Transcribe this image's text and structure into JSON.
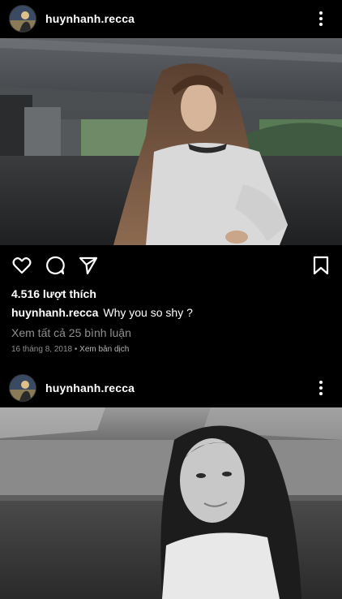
{
  "posts": [
    {
      "username": "huynhanh.recca",
      "avatar_icon": "profile-avatar",
      "more_icon": "more-vertical-icon",
      "likes": "4.516 lượt thích",
      "caption_user": "huynhanh.recca",
      "caption_text": "Why you so shy ?",
      "comments_link": "Xem tất cả 25 bình luận",
      "date": "16 tháng 8, 2018",
      "separator": "•",
      "translate_link": "Xem bản dịch"
    },
    {
      "username": "huynhanh.recca",
      "avatar_icon": "profile-avatar",
      "more_icon": "more-vertical-icon"
    }
  ],
  "action_icons": [
    "heart-icon",
    "comment-icon",
    "share-icon",
    "bookmark-icon"
  ],
  "colors": {
    "background": "#000000",
    "secondary_text": "#8e8e8e",
    "primary_text": "#ffffff"
  }
}
